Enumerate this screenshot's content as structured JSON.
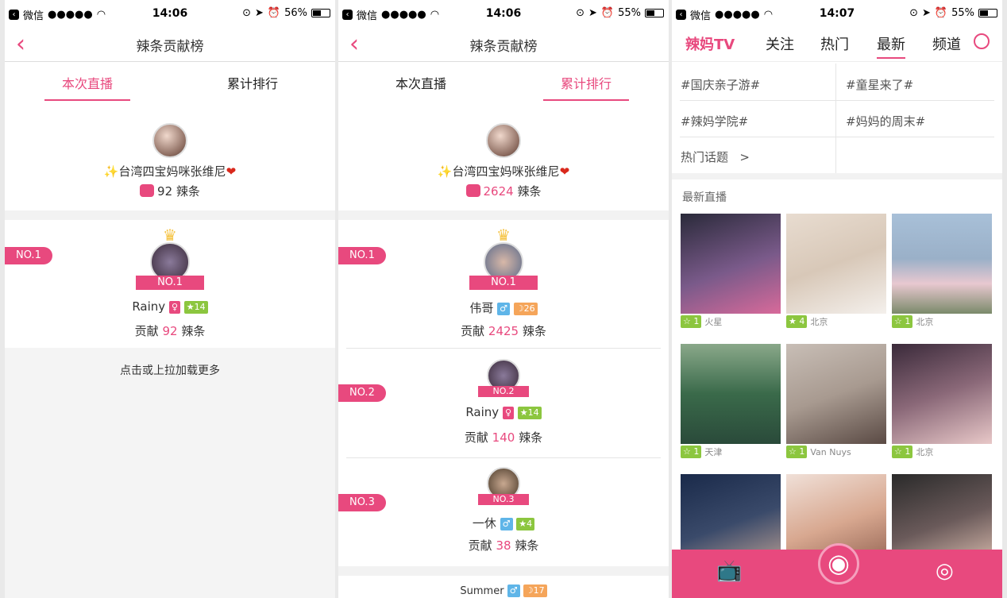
{
  "status": [
    {
      "carrier": "微信",
      "signal": "●●●●●",
      "time": "14:06",
      "battery": "56%"
    },
    {
      "carrier": "微信",
      "signal": "●●●●●",
      "time": "14:06",
      "battery": "55%"
    },
    {
      "carrier": "微信",
      "signal": "●●●●●",
      "time": "14:07",
      "battery": "55%"
    }
  ],
  "nav_title": "辣条贡献榜",
  "tabs": [
    "本次直播",
    "累计排行"
  ],
  "host": {
    "name": "台湾四宝妈咪张维尼",
    "unit": "辣条",
    "count_p1": "92",
    "count_p2": "2624"
  },
  "p1": {
    "rank1": {
      "badge": "NO.1",
      "ribbon": "NO.1",
      "name": "Rainy",
      "level": "14",
      "contrib_label": "贡献",
      "value": "92",
      "unit": "辣条"
    },
    "more": "点击或上拉加载更多"
  },
  "p2": {
    "rank1": {
      "badge": "NO.1",
      "ribbon": "NO.1",
      "name": "伟哥",
      "level": "26",
      "contrib_label": "贡献",
      "value": "2425",
      "unit": "辣条"
    },
    "rank2": {
      "badge": "NO.2",
      "ribbon": "NO.2",
      "name": "Rainy",
      "level": "14",
      "contrib_label": "贡献",
      "value": "140",
      "unit": "辣条"
    },
    "rank3": {
      "badge": "NO.3",
      "ribbon": "NO.3",
      "name": "一休",
      "level": "4",
      "contrib_label": "贡献",
      "value": "38",
      "unit": "辣条"
    },
    "rank4": {
      "name": "Summer",
      "level": "17"
    }
  },
  "p3": {
    "tabs": [
      "辣妈TV",
      "关注",
      "热门",
      "最新",
      "频道"
    ],
    "topics": [
      "#国庆亲子游#",
      "#童星来了#",
      "#辣妈学院#",
      "#妈妈的周末#",
      "热门话题",
      ">"
    ],
    "section": "最新直播",
    "lives": [
      {
        "level": "1",
        "loc": "火星",
        "color": "#7a5a8a"
      },
      {
        "level": "4",
        "loc": "北京",
        "color": "#d8c8b8"
      },
      {
        "level": "1",
        "loc": "北京",
        "color": "#9ab0c8"
      },
      {
        "level": "1",
        "loc": "天津",
        "color": "#3a6a4a"
      },
      {
        "level": "1",
        "loc": "Van Nuys",
        "color": "#a89a90"
      },
      {
        "level": "1",
        "loc": "北京",
        "color": "#8a6878"
      },
      {
        "level": "",
        "loc": "",
        "color": "#3a4a6a"
      },
      {
        "level": "",
        "loc": "",
        "color": "#d8a890"
      },
      {
        "level": "",
        "loc": "",
        "color": "#6a5a5a"
      }
    ]
  }
}
